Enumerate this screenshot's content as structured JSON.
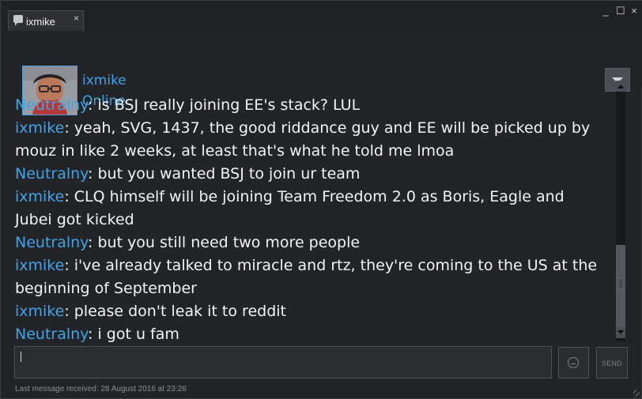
{
  "window": {
    "title": "ixmike"
  },
  "header": {
    "name": "ixmike",
    "status": "Online"
  },
  "messages": [
    {
      "sender": "Neutralny",
      "text": ": is BSJ really joining EE's stack? LUL"
    },
    {
      "sender": "ixmike",
      "text": ": yeah, SVG, 1437, the good riddance guy and EE will be picked up by mouz in like 2 weeks, at least that's what he told me lmoa"
    },
    {
      "sender": "Neutralny",
      "text": ": but you wanted BSJ to join ur team"
    },
    {
      "sender": "ixmike",
      "text": ": CLQ himself will be joining Team Freedom 2.0 as Boris, Eagle and Jubei got kicked"
    },
    {
      "sender": "Neutralny",
      "text": ": but you still need two more people"
    },
    {
      "sender": "ixmike",
      "text": ": i've already talked to miracle and rtz, they're coming to the US at the beginning of September"
    },
    {
      "sender": "ixmike",
      "text": ": please don't leak it to reddit"
    },
    {
      "sender": "Neutralny",
      "text": ": i got u fam"
    }
  ],
  "input": {
    "value": ""
  },
  "send": {
    "label": "SEND"
  },
  "footer": {
    "text": "Last message received: 28 August 2016 at 23:26"
  },
  "icons": {
    "chat": "chat-icon",
    "close": "close-icon",
    "minimize": "minimize-icon",
    "maximize": "maximize-icon",
    "dropdown": "chevron-down-icon",
    "emoji": "emoji-icon",
    "resize": "resize-grip-icon"
  },
  "colors": {
    "accent": "#3fa5e6",
    "text": "#f3f4f6",
    "background": "#232428"
  }
}
